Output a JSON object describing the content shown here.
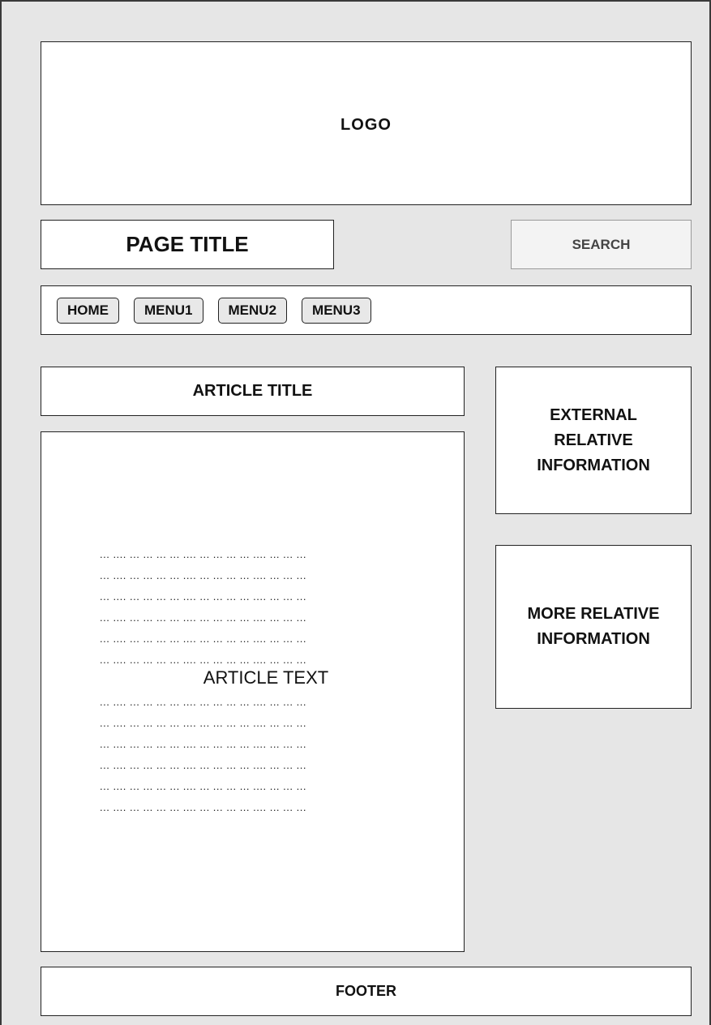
{
  "logo": "LOGO",
  "page_title": "PAGE TITLE",
  "search_label": "SEARCH",
  "nav": [
    "HOME",
    "MENU1",
    "MENU2",
    "MENU3"
  ],
  "article": {
    "title": "ARTICLE TITLE",
    "text_label": "ARTICLE TEXT",
    "filler_line": "... .... ... ... ... ... .... ... ... ... ... .... ... ... ..."
  },
  "sidebar": {
    "box1": "EXTERNAL RELATIVE INFORMATION",
    "box2": "MORE RELATIVE INFORMATION"
  },
  "footer": "FOOTER"
}
